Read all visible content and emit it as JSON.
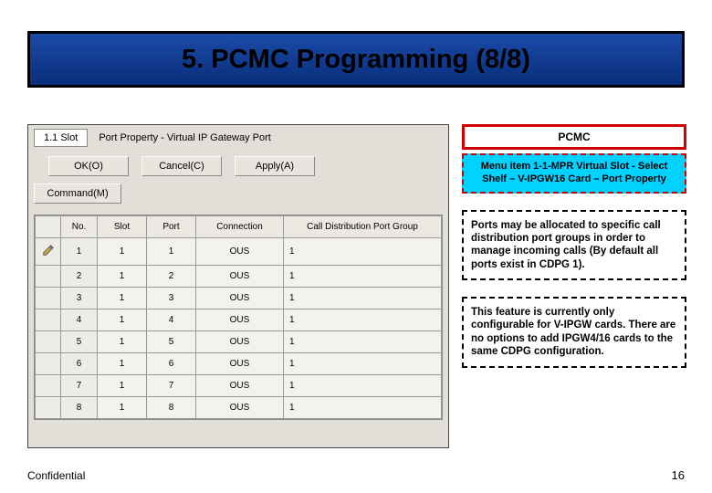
{
  "title": "5. PCMC Programming (8/8)",
  "panel": {
    "slot_label": "1.1 Slot",
    "property_title": "Port Property - Virtual IP Gateway Port",
    "buttons": {
      "ok": "OK(O)",
      "cancel": "Cancel(C)",
      "apply": "Apply(A)"
    },
    "command_btn": "Command(M)",
    "columns": {
      "no": "No.",
      "slot": "Slot",
      "port": "Port",
      "connection": "Connection",
      "cdpg": "Call Distribution Port Group"
    },
    "rows": [
      {
        "no": "1",
        "slot": "1",
        "port": "1",
        "connection": "OUS",
        "cdpg": "1"
      },
      {
        "no": "2",
        "slot": "1",
        "port": "2",
        "connection": "OUS",
        "cdpg": "1"
      },
      {
        "no": "3",
        "slot": "1",
        "port": "3",
        "connection": "OUS",
        "cdpg": "1"
      },
      {
        "no": "4",
        "slot": "1",
        "port": "4",
        "connection": "OUS",
        "cdpg": "1"
      },
      {
        "no": "5",
        "slot": "1",
        "port": "5",
        "connection": "OUS",
        "cdpg": "1"
      },
      {
        "no": "6",
        "slot": "1",
        "port": "6",
        "connection": "OUS",
        "cdpg": "1"
      },
      {
        "no": "7",
        "slot": "1",
        "port": "7",
        "connection": "OUS",
        "cdpg": "1"
      },
      {
        "no": "8",
        "slot": "1",
        "port": "8",
        "connection": "OUS",
        "cdpg": "1"
      }
    ]
  },
  "notes": {
    "pcmc": "PCMC",
    "menu_path": "Menu item 1-1-MPR Virtual Slot - Select Shelf – V-IPGW16 Card – Port Property",
    "note1": "Ports may be allocated to specific call distribution port groups in order to manage incoming calls (By default all ports exist in CDPG 1).",
    "note2": "This feature is currently only configurable for V-IPGW cards. There are no options to add IPGW4/16 cards to the same CDPG configuration."
  },
  "footer": {
    "left": "Confidential",
    "right": "16"
  }
}
